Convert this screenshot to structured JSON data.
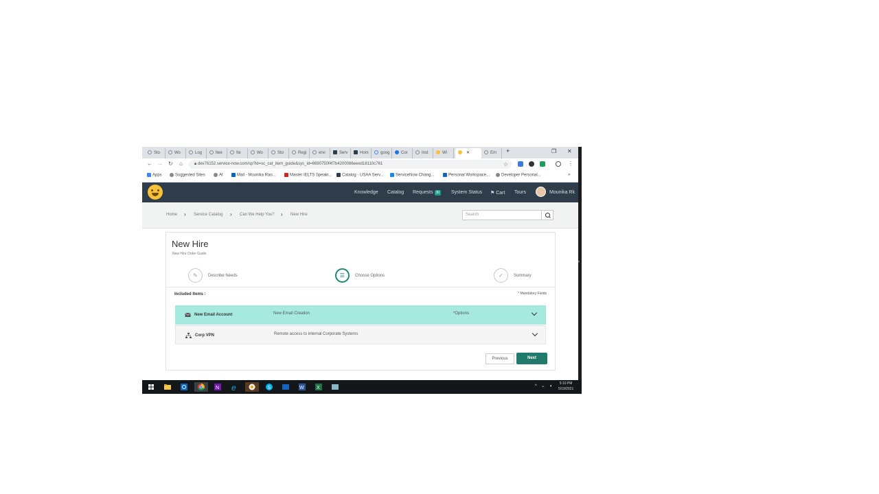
{
  "browser": {
    "tabs": [
      {
        "label": "Sto"
      },
      {
        "label": "Wo"
      },
      {
        "label": "Log"
      },
      {
        "label": "ltee"
      },
      {
        "label": "Ite"
      },
      {
        "label": "Wo"
      },
      {
        "label": "Sto"
      },
      {
        "label": "Regi"
      },
      {
        "label": "ervi"
      },
      {
        "label": "Serv"
      },
      {
        "label": "Hom"
      },
      {
        "label": "goog"
      },
      {
        "label": "Cor"
      },
      {
        "label": "Inst"
      },
      {
        "label": "Wi"
      },
      {
        "label": ""
      },
      {
        "label": "Em"
      }
    ],
    "url": "dev76152.service-now.com/sp?id=sc_cat_item_guide&sys_id=6690750f4f7b4200086eeed18110c761",
    "bookmarks": [
      {
        "label": "Apps"
      },
      {
        "label": "Suggested Sites"
      },
      {
        "label": "AI"
      },
      {
        "label": "Mail - Mounika Rao..."
      },
      {
        "label": "Master IELTS Speaki..."
      },
      {
        "label": "Catalog - USAA Serv..."
      },
      {
        "label": "ServiceNow Chang..."
      },
      {
        "label": "Personal Workspace..."
      },
      {
        "label": "Developer Personal..."
      }
    ],
    "more_bookmarks": "»"
  },
  "header": {
    "nav": [
      "Knowledge",
      "Catalog",
      "Requests",
      "System Status",
      "Cart",
      "Tours"
    ],
    "requests_badge": "30",
    "user_name": "Mounika Rk"
  },
  "breadcrumb": {
    "items": [
      "Home",
      "Service Catalog",
      "Can We Help You?",
      "New Hire"
    ],
    "separator": "›"
  },
  "search": {
    "placeholder": "Search"
  },
  "page": {
    "title": "New Hire",
    "subtitle": "New Hire Order Guide",
    "steps": [
      {
        "label": "Describe Needs",
        "icon": "edit-icon"
      },
      {
        "label": "Choose Options",
        "icon": "list-icon",
        "active": true
      },
      {
        "label": "Summary",
        "icon": "check-icon"
      }
    ],
    "included_items_label": "Included Items :",
    "mandatory_label": "Mandatory Fields",
    "items": [
      {
        "name": "New Email Account",
        "description": "New Email Creation",
        "options": "Options",
        "icon": "envelope-icon",
        "highlight_color": "#a6e9df"
      },
      {
        "name": "Corp VPN",
        "description": "Remote access to internal Corporate Systems",
        "icon": "network-icon"
      }
    ],
    "previous_label": "Previous",
    "next_label": "Next"
  },
  "taskbar": {
    "clock_time": "5:10 PM",
    "clock_date": "5/19/2021"
  },
  "colors": {
    "header_bg": "#2e3d49",
    "accent": "#217b6c",
    "badge": "#1b9d8b",
    "required": "#d32f2f"
  }
}
